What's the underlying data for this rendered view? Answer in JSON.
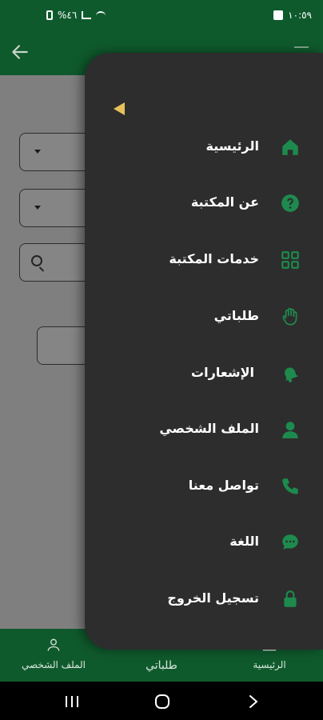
{
  "status_bar": {
    "time": "١٠:٥٩",
    "battery": "%٤٦"
  },
  "drawer": {
    "items": [
      {
        "label": "الرئيسية",
        "icon": "home-icon"
      },
      {
        "label": "عن المكتبة",
        "icon": "help-circle-icon"
      },
      {
        "label": "خدمات المكتبة",
        "icon": "grid-icon"
      },
      {
        "label": "طلباتي",
        "icon": "hand-icon"
      },
      {
        "label": "الإشعارات",
        "icon": "bell-icon"
      },
      {
        "label": "الملف الشخصي",
        "icon": "person-icon"
      },
      {
        "label": "تواصل معنا",
        "icon": "phone-icon"
      },
      {
        "label": "اللغة",
        "icon": "chat-bubble-icon"
      },
      {
        "label": "تسجيل الخروج",
        "icon": "lock-icon"
      }
    ]
  },
  "bottom_nav": {
    "profile": "الملف الشخصي",
    "requests": "طلباتي",
    "home": "الرئيسية"
  },
  "colors": {
    "brand_green": "#0f5a2d",
    "drawer_bg": "#2d2d2d",
    "icon_green": "#1e8a4e",
    "accent_yellow": "#e6c15a"
  }
}
